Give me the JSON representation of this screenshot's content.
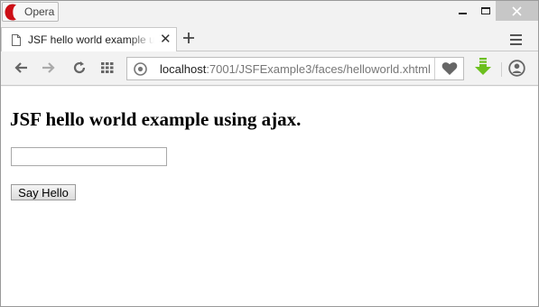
{
  "titlebar": {
    "app_label": "Opera",
    "colors": {
      "opera_red": "#cc0f16"
    }
  },
  "tabs": [
    {
      "title": "JSF hello world example using ajax",
      "icon": "page-icon",
      "close_icon": "close-icon"
    }
  ],
  "toolbar": {
    "new_tab_icon": "plus-icon",
    "tab_menu_icon": "menu-icon",
    "back_icon": "back-arrow-icon",
    "forward_icon": "forward-arrow-icon",
    "reload_icon": "reload-icon",
    "speed_dial_icon": "grid-icon",
    "heart_icon": "heart-icon",
    "download_icon": "download-icon",
    "account_icon": "account-icon",
    "colors": {
      "download_green": "#6cbf1e"
    }
  },
  "address": {
    "host": "localhost",
    "rest": ":7001/JSFExample3/faces/helloworld.xhtml"
  },
  "page": {
    "heading": "JSF hello world example using ajax.",
    "input_value": "",
    "button_label": "Say Hello"
  }
}
